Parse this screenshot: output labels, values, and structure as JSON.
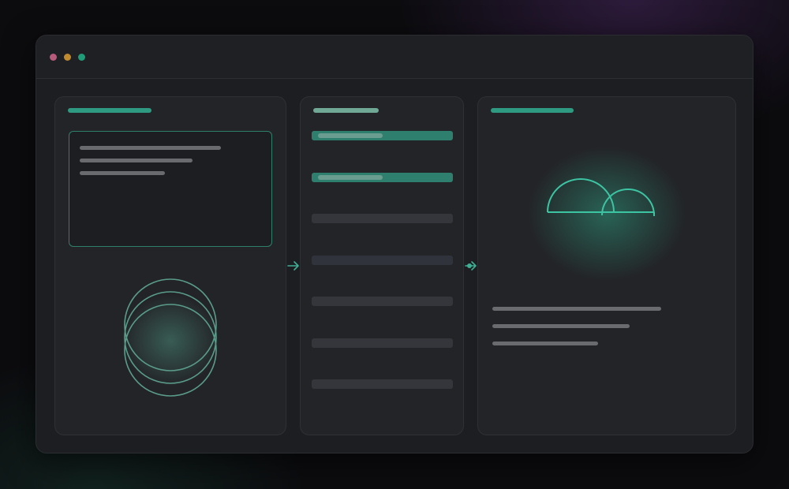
{
  "window": {
    "controls": [
      {
        "name": "close",
        "color": "#b85a7a"
      },
      {
        "name": "minimize",
        "color": "#c08a2e"
      },
      {
        "name": "maximize",
        "color": "#1f9d78"
      }
    ]
  },
  "colors": {
    "accent": "#2fa88c",
    "accent_soft": "#7fb7a5",
    "panel_bg": "#232427",
    "window_bg": "#1d1e21",
    "placeholder_text": "#6a6b6f"
  },
  "panels": [
    {
      "id": "input",
      "content": [
        "text-block",
        "overlapping-circles-icon"
      ]
    },
    {
      "id": "list",
      "rows": [
        {
          "state": "active"
        },
        {
          "state": "active"
        },
        {
          "state": "idle"
        },
        {
          "state": "idle-dim"
        },
        {
          "state": "idle"
        },
        {
          "state": "idle"
        },
        {
          "state": "idle"
        }
      ]
    },
    {
      "id": "output",
      "content": [
        "cloud-arcs-icon",
        "text-block"
      ]
    }
  ],
  "icons": [
    "flow-arrow-icon",
    "flow-arrow-icon",
    "overlapping-circles-icon",
    "cloud-arcs-icon"
  ]
}
